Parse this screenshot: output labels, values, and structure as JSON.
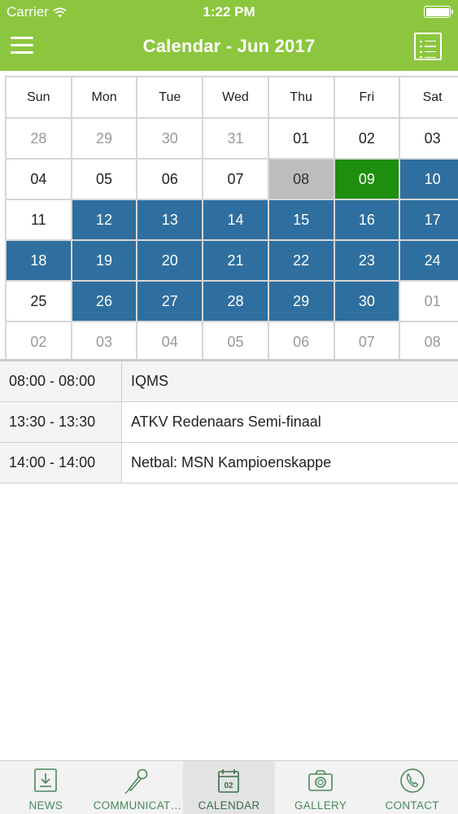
{
  "status_bar": {
    "carrier": "Carrier",
    "time": "1:22 PM"
  },
  "header": {
    "title": "Calendar - Jun 2017",
    "color": "#8cc63e"
  },
  "calendar": {
    "weekdays": [
      "Sun",
      "Mon",
      "Tue",
      "Wed",
      "Thu",
      "Fri",
      "Sat"
    ],
    "weeks": [
      [
        {
          "d": "28",
          "s": "other"
        },
        {
          "d": "29",
          "s": "other"
        },
        {
          "d": "30",
          "s": "other"
        },
        {
          "d": "31",
          "s": "other"
        },
        {
          "d": "01",
          "s": ""
        },
        {
          "d": "02",
          "s": ""
        },
        {
          "d": "03",
          "s": ""
        }
      ],
      [
        {
          "d": "04",
          "s": ""
        },
        {
          "d": "05",
          "s": ""
        },
        {
          "d": "06",
          "s": ""
        },
        {
          "d": "07",
          "s": ""
        },
        {
          "d": "08",
          "s": "today"
        },
        {
          "d": "09",
          "s": "active"
        },
        {
          "d": "10",
          "s": "selected"
        }
      ],
      [
        {
          "d": "11",
          "s": ""
        },
        {
          "d": "12",
          "s": "selected"
        },
        {
          "d": "13",
          "s": "selected"
        },
        {
          "d": "14",
          "s": "selected"
        },
        {
          "d": "15",
          "s": "selected"
        },
        {
          "d": "16",
          "s": "selected"
        },
        {
          "d": "17",
          "s": "selected"
        }
      ],
      [
        {
          "d": "18",
          "s": "selected"
        },
        {
          "d": "19",
          "s": "selected"
        },
        {
          "d": "20",
          "s": "selected"
        },
        {
          "d": "21",
          "s": "selected"
        },
        {
          "d": "22",
          "s": "selected"
        },
        {
          "d": "23",
          "s": "selected"
        },
        {
          "d": "24",
          "s": "selected"
        }
      ],
      [
        {
          "d": "25",
          "s": ""
        },
        {
          "d": "26",
          "s": "selected"
        },
        {
          "d": "27",
          "s": "selected"
        },
        {
          "d": "28",
          "s": "selected"
        },
        {
          "d": "29",
          "s": "selected"
        },
        {
          "d": "30",
          "s": "selected"
        },
        {
          "d": "01",
          "s": "other"
        }
      ],
      [
        {
          "d": "02",
          "s": "other"
        },
        {
          "d": "03",
          "s": "other"
        },
        {
          "d": "04",
          "s": "other"
        },
        {
          "d": "05",
          "s": "other"
        },
        {
          "d": "06",
          "s": "other"
        },
        {
          "d": "07",
          "s": "other"
        },
        {
          "d": "08",
          "s": "other"
        }
      ]
    ],
    "colors": {
      "selected": "#2f6f9f",
      "today": "#bdbdbd",
      "active": "#1e8e0e"
    }
  },
  "events": [
    {
      "time": "08:00 - 08:00",
      "title": "IQMS"
    },
    {
      "time": "13:30 - 13:30",
      "title": "ATKV Redenaars Semi-finaal"
    },
    {
      "time": "14:00 - 14:00",
      "title": "Netbal: MSN Kampioenskappe"
    }
  ],
  "tabbar": {
    "items": [
      {
        "label": "NEWS",
        "icon": "news-icon"
      },
      {
        "label": "COMMUNICATI...",
        "icon": "microphone-icon"
      },
      {
        "label": "CALENDAR",
        "icon": "calendar-icon",
        "active": true
      },
      {
        "label": "GALLERY",
        "icon": "camera-icon"
      },
      {
        "label": "CONTACT",
        "icon": "phone-icon"
      }
    ]
  }
}
